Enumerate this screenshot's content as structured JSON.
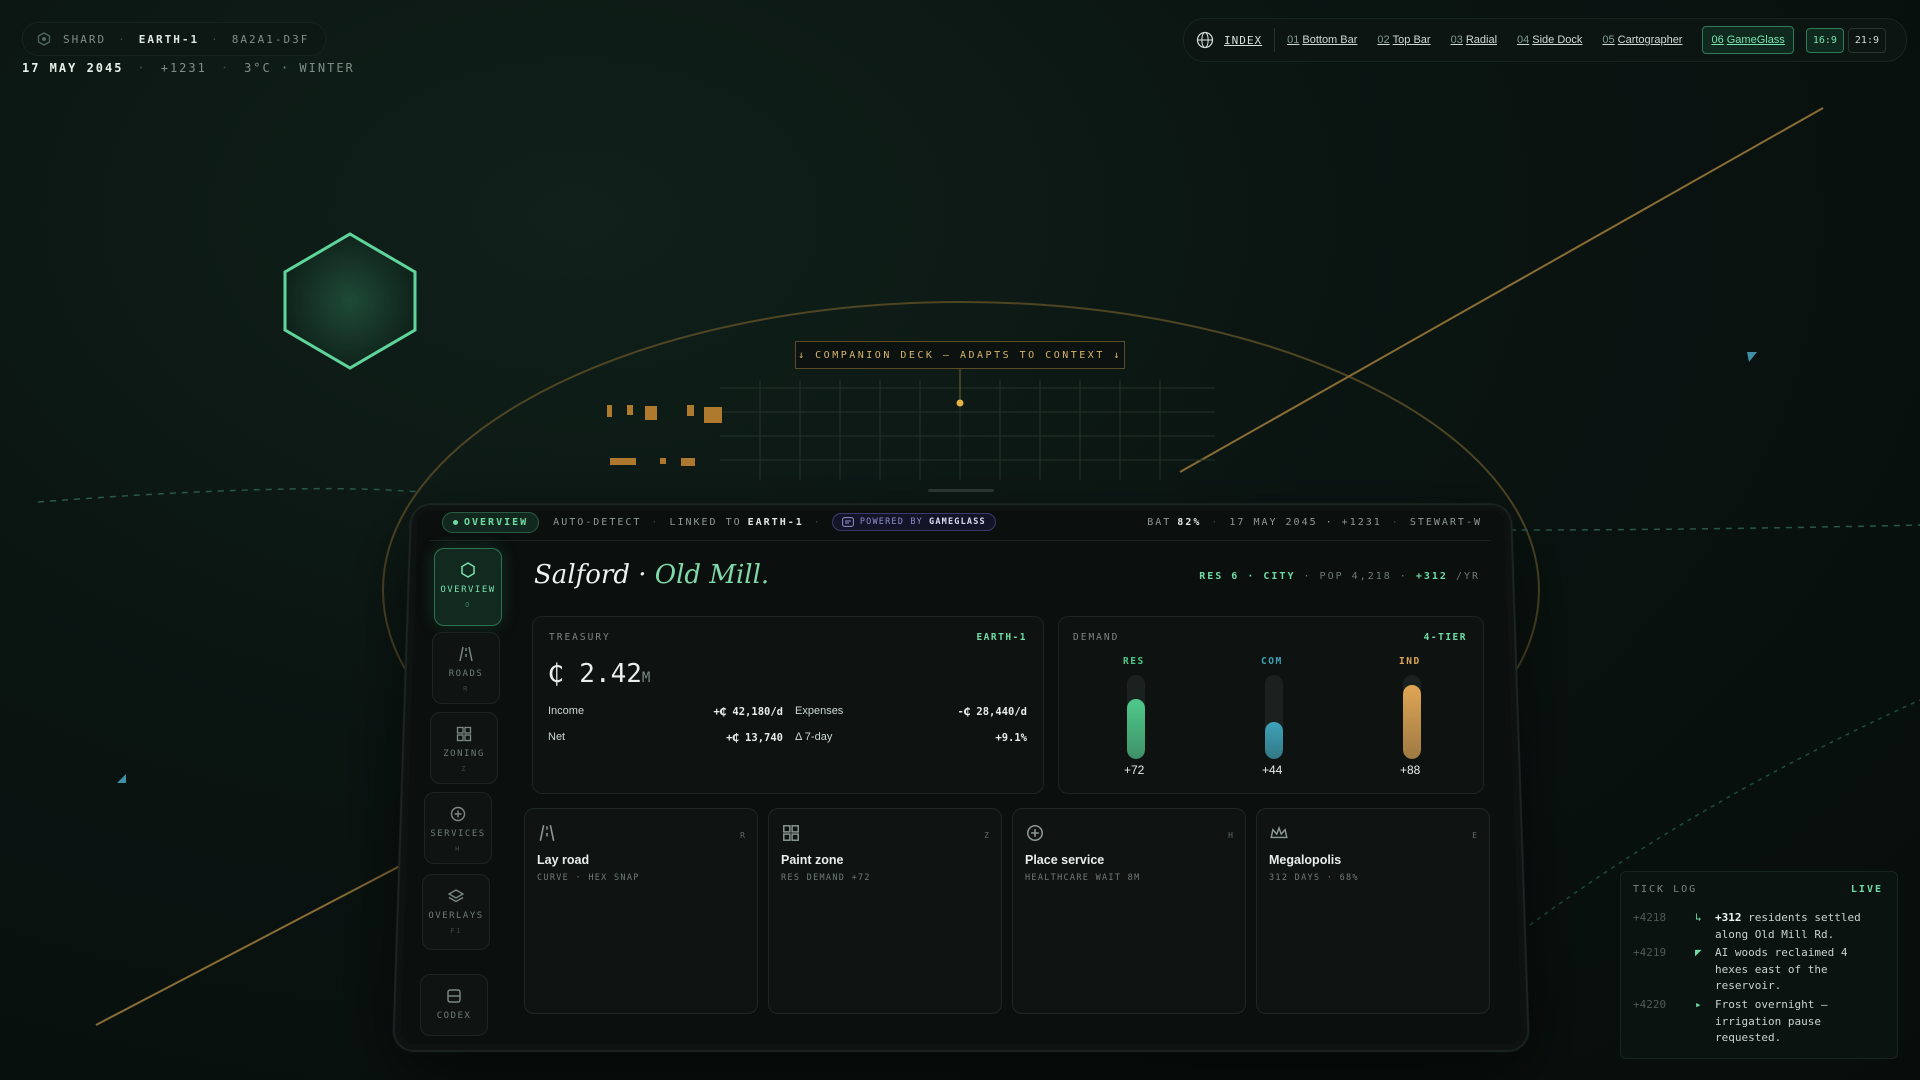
{
  "status": {
    "label": "SHARD",
    "world": "EARTH-1",
    "hash": "8A2A1-D3F"
  },
  "date_line": {
    "date": "17 MAY 2045",
    "tick": "+1231",
    "weather": "3°C · WINTER"
  },
  "nav": {
    "index": "INDEX",
    "links": [
      {
        "num": "01",
        "label": "Bottom Bar"
      },
      {
        "num": "02",
        "label": "Top Bar"
      },
      {
        "num": "03",
        "label": "Radial"
      },
      {
        "num": "04",
        "label": "Side Dock"
      },
      {
        "num": "05",
        "label": "Cartographer"
      },
      {
        "num": "06",
        "label": "GameGlass"
      }
    ],
    "active_index": 5,
    "ratios": [
      "16:9",
      "21:9"
    ],
    "active_ratio": 0
  },
  "banner": "↓ COMPANION DECK — ADAPTS TO CONTEXT ↓",
  "device": {
    "mode": "OVERVIEW",
    "auto": "AUTO-DETECT",
    "linked_prefix": "LINKED TO",
    "linked_world": "EARTH-1",
    "powered_prefix": "POWERED BY",
    "powered_brand": "GAMEGLASS",
    "bat_label": "BAT",
    "bat_value": "82%",
    "date": "17 MAY 2045 · +1231",
    "user": "STEWART-W"
  },
  "sidebar": [
    {
      "label": "OVERVIEW",
      "key": "O",
      "icon": "hexagon-icon"
    },
    {
      "label": "ROADS",
      "key": "R",
      "icon": "road-icon"
    },
    {
      "label": "ZONING",
      "key": "Z",
      "icon": "grid-icon"
    },
    {
      "label": "SERVICES",
      "key": "H",
      "icon": "plus-circle-icon"
    },
    {
      "label": "OVERLAYS",
      "key": "F1",
      "icon": "layers-icon"
    },
    {
      "label": "CODEX",
      "key": "",
      "icon": "book-icon"
    }
  ],
  "city": {
    "name": "Salford",
    "district": "Old Mill.",
    "res_tier": "RES 6 · CITY",
    "pop": "POP 4,218",
    "growth": "+312",
    "growth_unit": "/YR"
  },
  "treasury": {
    "label": "TREASURY",
    "tag": "EARTH-1",
    "value": "₵ 2.42",
    "unit": "M",
    "income_label": "Income",
    "income": "+₵ 42,180/d",
    "expenses_label": "Expenses",
    "expenses": "-₵ 28,440/d",
    "net_label": "Net",
    "net": "+₵ 13,740",
    "delta_label": "Δ 7-day",
    "delta": "+9.1%"
  },
  "demand": {
    "label": "DEMAND",
    "tag": "4-TIER",
    "bars": [
      {
        "name": "RES",
        "value": "+72",
        "level": 0.72,
        "color": "#4fc98a"
      },
      {
        "name": "COM",
        "value": "+44",
        "level": 0.44,
        "color": "#3fa3b8"
      },
      {
        "name": "IND",
        "value": "+88",
        "level": 0.88,
        "color": "#e0a655"
      }
    ]
  },
  "actions": [
    {
      "title": "Lay road",
      "desc": "CURVE · HEX SNAP",
      "key": "R",
      "icon": "road-icon"
    },
    {
      "title": "Paint zone",
      "desc": "RES DEMAND +72",
      "key": "Z",
      "icon": "grid-icon"
    },
    {
      "title": "Place service",
      "desc": "HEALTHCARE WAIT 8M",
      "key": "H",
      "icon": "plus-circle-icon"
    },
    {
      "title": "Megalopolis",
      "desc": "312 DAYS · 68%",
      "key": "E",
      "icon": "crown-icon"
    }
  ],
  "tick_log": {
    "title": "TICK LOG",
    "live": "LIVE",
    "entries": [
      {
        "num": "+4218",
        "marker": "↳",
        "bold": "+312",
        "text": " residents settled along Old Mill Rd."
      },
      {
        "num": "+4219",
        "marker": "◤",
        "bold": "",
        "text": "AI woods reclaimed 4 hexes east of the reservoir."
      },
      {
        "num": "+4220",
        "marker": "▸",
        "bold": "",
        "text": "Frost overnight — irrigation pause requested."
      }
    ]
  }
}
